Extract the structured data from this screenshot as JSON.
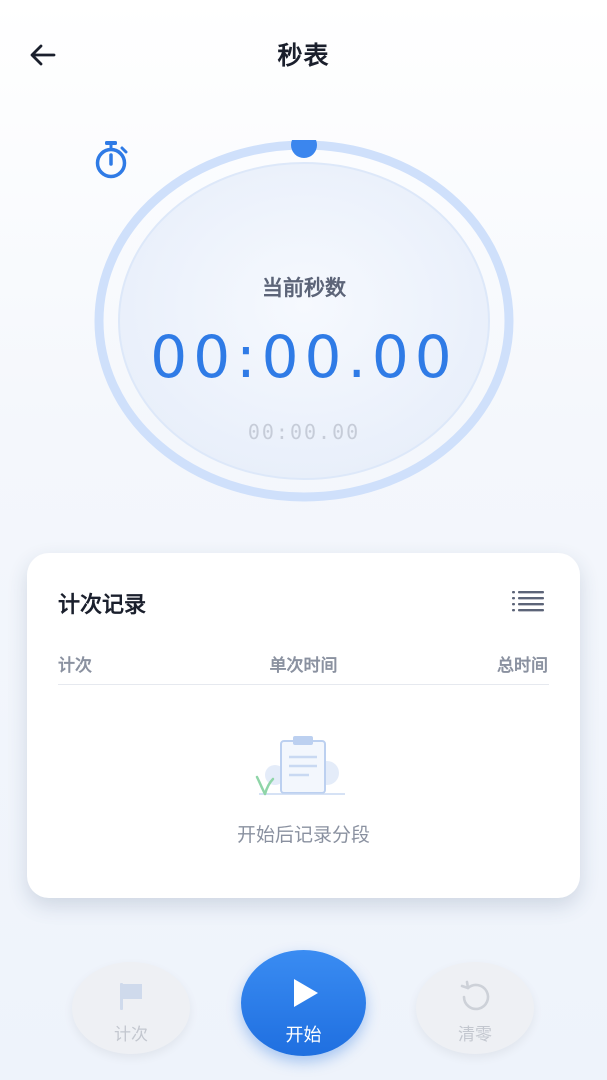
{
  "header": {
    "title": "秒表",
    "back_icon": "arrow-left-icon"
  },
  "timer": {
    "label": "当前秒数",
    "main_time": "00:00.00",
    "secondary_time": "00:00.00",
    "icon": "stopwatch-icon",
    "accent_color": "#2f7be6"
  },
  "laps": {
    "title": "计次记录",
    "list_icon": "list-icon",
    "columns": [
      "计次",
      "单次时间",
      "总时间"
    ],
    "empty_text": "开始后记录分段",
    "rows": []
  },
  "controls": {
    "lap_label": "计次",
    "start_label": "开始",
    "reset_label": "清零"
  }
}
